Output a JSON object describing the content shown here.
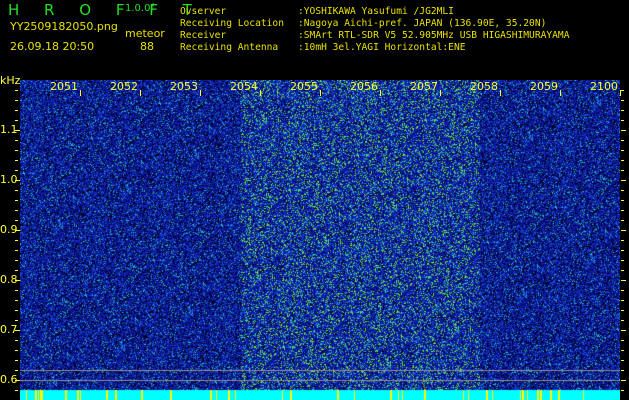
{
  "header": {
    "title": "H R O F F T",
    "version": "1.0.0f",
    "filename": "YY2509182050.png",
    "datetime": "26.09.18 20:50",
    "meteor_label": "meteor",
    "meteor_count": "88"
  },
  "info": [
    {
      "label": "Ovserver",
      "value": ":YOSHIKAWA Yasufumi /JG2MLI"
    },
    {
      "label": "Receiving Location",
      "value": ":Nagoya Aichi-pref. JAPAN (136.90E, 35.20N)"
    },
    {
      "label": "Receiver",
      "value": ":SMArt RTL-SDR V5 52.905MHz USB HIGASHIMURAYAMA"
    },
    {
      "label": "Receiving Antenna",
      "value": ":10mH 3el.YAGI Horizontal:ENE"
    }
  ],
  "spectrogram": {
    "y_unit": "kHz",
    "x_labels": [
      "2051",
      "2052",
      "2053",
      "2054",
      "2055",
      "2056",
      "2057",
      "2058",
      "2059",
      "2100"
    ],
    "y_labels": [
      "1.1",
      "1.0",
      "0.9",
      "0.8",
      "0.7",
      "0.6"
    ],
    "colors": {
      "background": "#000000",
      "text": "#e8e000",
      "title": "#22e022",
      "noise_low": "#0a1a9a",
      "noise_high": "#30d0a0",
      "bottom_band": "#00ffff"
    }
  }
}
